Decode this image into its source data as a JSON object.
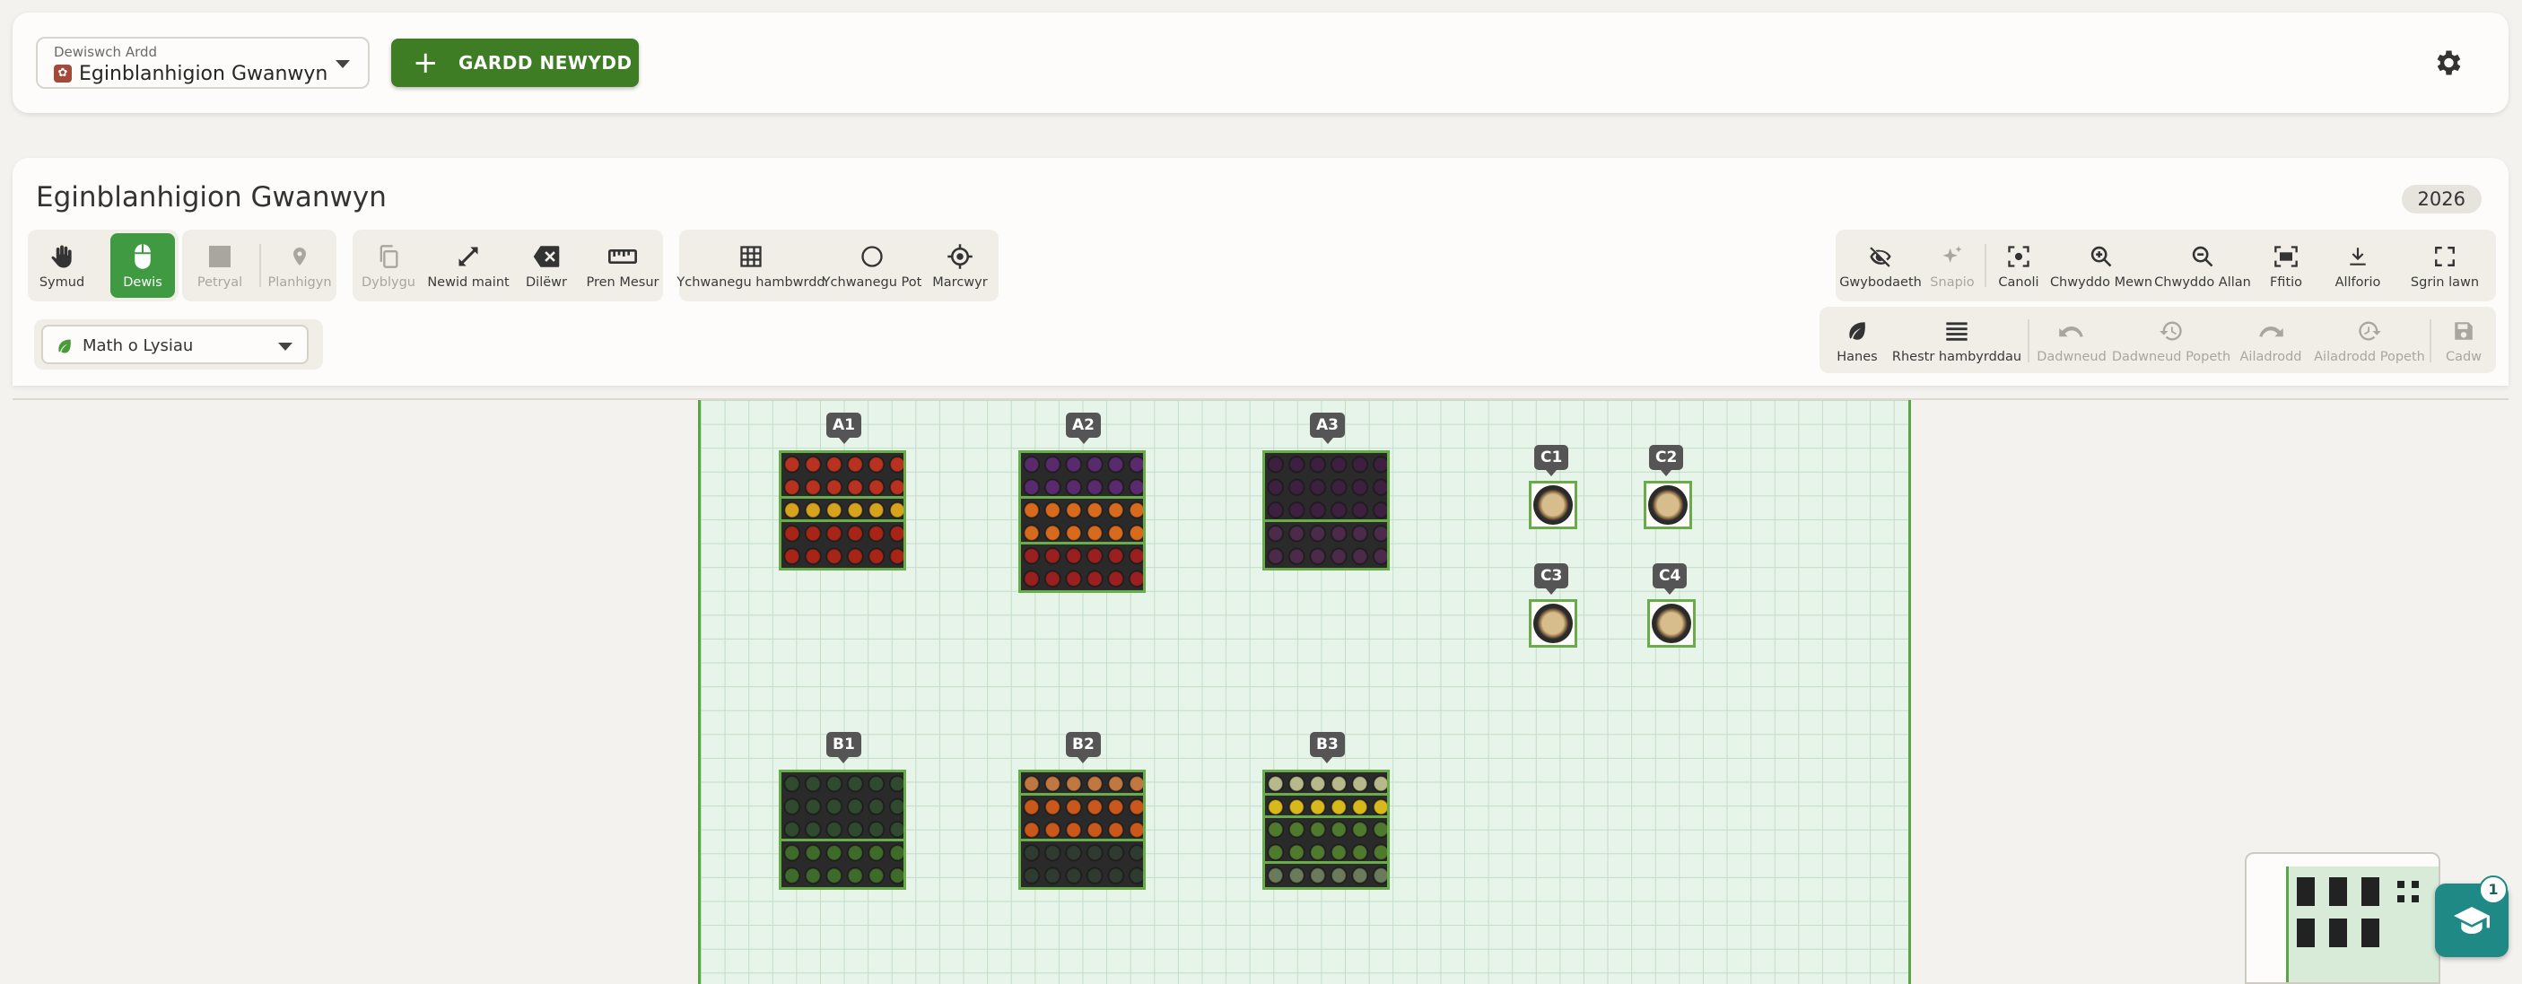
{
  "topbar": {
    "garden_select_label": "Dewiswch Ardd",
    "garden_select_value": "Eginblanhigion Gwanwyn",
    "new_garden_label": "GARDD NEWYDD"
  },
  "panel": {
    "title": "Eginblanhigion Gwanwyn",
    "year": "2026"
  },
  "toolbar": {
    "pan": "Symud",
    "select": "Dewis",
    "rectangle": "Petryal",
    "plant": "Planhigyn",
    "duplicate": "Dyblygu",
    "resize": "Newid maint",
    "delete": "Dilëwr",
    "ruler": "Pren Mesur",
    "add_tray": "Ychwanegu hambwrdd",
    "add_pot": "Ychwanegu Pot",
    "marker": "Marcwyr",
    "visibility": "Gwybodaeth",
    "snap": "Snapio",
    "center": "Canoli",
    "zoom_in": "Chwyddo Mewn",
    "zoom_out": "Chwyddo Allan",
    "fit": "Ffitio",
    "export": "Allforio",
    "fullscreen": "Sgrin lawn",
    "history": "Hanes",
    "tray_list": "Rhestr hambyrddau",
    "undo": "Dadwneud",
    "undo_all": "Dadwneud Popeth",
    "redo": "Ailadrodd",
    "redo_all": "Ailadrodd Popeth",
    "save": "Cadw"
  },
  "veg_select": {
    "placeholder": "Math o Lysiau"
  },
  "canvas": {
    "beds": [
      {
        "id": "A1",
        "sections": [
          {
            "rows": 2,
            "color": "#b8321f"
          },
          {
            "rows": 1,
            "color": "#d7a21c"
          },
          {
            "rows": 2,
            "color": "#a72417"
          }
        ]
      },
      {
        "id": "A2",
        "sections": [
          {
            "rows": 2,
            "color": "#5a2a6e"
          },
          {
            "rows": 2,
            "color": "#d86a1e"
          },
          {
            "rows": 2,
            "color": "#9a1f1f"
          }
        ]
      },
      {
        "id": "A3",
        "sections": [
          {
            "rows": 3,
            "color": "#3d1f3f"
          },
          {
            "rows": 2,
            "color": "#4b2a4a"
          }
        ]
      },
      {
        "id": "B1",
        "sections": [
          {
            "rows": 3,
            "color": "#2f4a2e"
          },
          {
            "rows": 2,
            "color": "#3f6b2a"
          }
        ]
      },
      {
        "id": "B2",
        "sections": [
          {
            "rows": 1,
            "color": "#c07840"
          },
          {
            "rows": 2,
            "color": "#c9581a"
          },
          {
            "rows": 2,
            "color": "#2f3a30"
          }
        ]
      },
      {
        "id": "B3",
        "sections": [
          {
            "rows": 1,
            "color": "#b8b98a"
          },
          {
            "rows": 1,
            "color": "#d8b81a"
          },
          {
            "rows": 2,
            "color": "#4f7a2e"
          },
          {
            "rows": 1,
            "color": "#6a7a5a"
          }
        ]
      }
    ],
    "pots": [
      "C1",
      "C2",
      "C3",
      "C4"
    ]
  },
  "help": {
    "badge": "1"
  },
  "colors": {
    "accent": "#3f7d25",
    "active_tool": "#3f9a42",
    "bed_border": "#69ad4b",
    "help": "#1f8a85"
  }
}
